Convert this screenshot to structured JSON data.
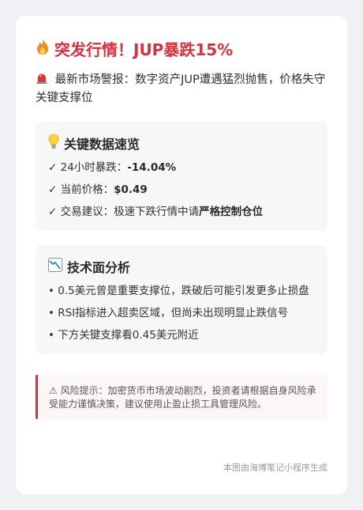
{
  "header": {
    "icon": "fire-icon",
    "title": "突发行情！JUP暴跌15%"
  },
  "alert": {
    "icon": "siren-icon",
    "text": "最新市场警报：数字资产JUP遭遇猛烈抛售，价格失守关键支撑位"
  },
  "key_data": {
    "icon": "lightbulb-icon",
    "title": "关键数据速览",
    "items": [
      {
        "mark": "✓",
        "label": "24小时暴跌：",
        "value": "-14.04%"
      },
      {
        "mark": "✓",
        "label": "当前价格：",
        "value": "$0.49"
      },
      {
        "mark": "✓",
        "label": "交易建议：极速下跌行情中请",
        "value": "严格控制仓位"
      }
    ]
  },
  "technical": {
    "icon": "chart-down-icon",
    "title": "技术面分析",
    "items": [
      "• 0.5美元曾是重要支撑位，跌破后可能引发更多止损盘",
      "• RSI指标进入超卖区域，但尚未出现明显止跌信号",
      "• 下方关键支撑看0.45美元附近"
    ]
  },
  "risk": {
    "icon": "warning-icon",
    "text": "⚠ 风险提示：加密货币市场波动剧烈，投资者请根据自身风险承受能力谨慎决策，建议使用止盈止损工具管理风险。"
  },
  "footer": {
    "text": "本图由海博笔记小程序生成"
  },
  "colors": {
    "accent": "#d9303d",
    "panel_bg": "#f6f7f9",
    "page_bg": "#f0f1f5"
  }
}
